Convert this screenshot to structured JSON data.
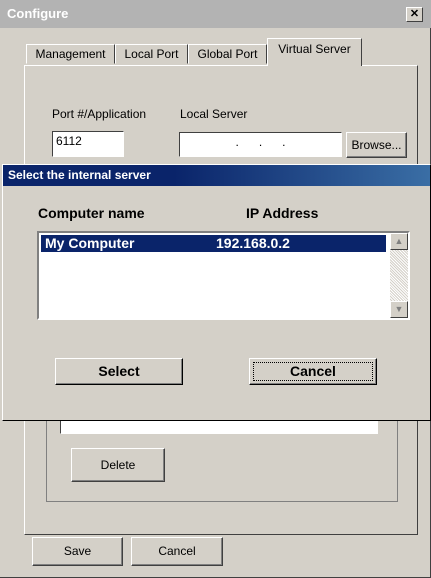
{
  "configure_window": {
    "title": "Configure",
    "close_glyph": "✕",
    "tabs": [
      "Management",
      "Local Port",
      "Global Port",
      "Virtual Server"
    ],
    "active_tab": "Virtual Server",
    "port_label": "Port #/Application",
    "port_value": "6112",
    "local_server_label": "Local Server",
    "local_server_value": ".      .      .",
    "browse_label": "Browse...",
    "delete_label": "Delete",
    "save_label": "Save",
    "cancel_label": "Cancel"
  },
  "select_dialog": {
    "title": "Select the internal server",
    "columns": [
      "Computer name",
      "IP Address"
    ],
    "rows": [
      {
        "name": "My Computer",
        "ip": "192.168.0.2",
        "selected": true
      }
    ],
    "select_label": "Select",
    "cancel_label": "Cancel"
  },
  "colors": {
    "selection": "#0a246a",
    "face": "#d4d0c8"
  }
}
